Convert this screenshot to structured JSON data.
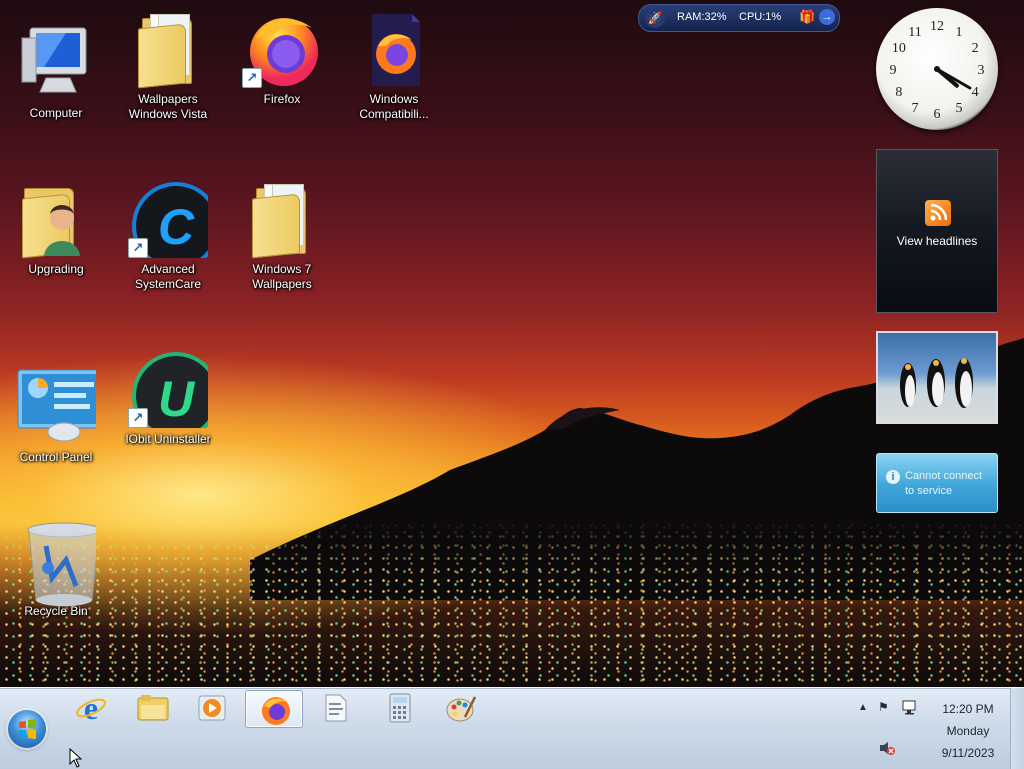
{
  "desktop": {
    "icons": [
      {
        "label": "Computer",
        "icon": "computer-icon"
      },
      {
        "label": "Wallpapers Windows Vista",
        "icon": "folder-icon"
      },
      {
        "label": "Firefox",
        "icon": "firefox-icon",
        "shortcut": true
      },
      {
        "label": "Windows Compatibili...",
        "icon": "firefox-document-icon"
      },
      {
        "label": "Upgrading",
        "icon": "user-folder-icon"
      },
      {
        "label": "Advanced SystemCare",
        "icon": "advanced-systemcare-icon",
        "shortcut": true
      },
      {
        "label": "Windows 7 Wallpapers",
        "icon": "folder-icon"
      },
      {
        "label": "Control Panel",
        "icon": "control-panel-icon"
      },
      {
        "label": "IObit Uninstaller",
        "icon": "iobit-uninstaller-icon",
        "shortcut": true
      },
      {
        "label": "Recycle Bin",
        "icon": "recycle-bin-icon"
      }
    ]
  },
  "gadgets": {
    "system_monitor": {
      "ram": "RAM:32%",
      "cpu": "CPU:1%"
    },
    "clock": {
      "hours": 4,
      "minutes": 20,
      "numerals": [
        "12",
        "1",
        "2",
        "3",
        "4",
        "5",
        "6",
        "7",
        "8",
        "9",
        "10",
        "11"
      ]
    },
    "feed_headlines": {
      "label": "View headlines"
    },
    "slideshow": {
      "subject": "penguins"
    },
    "weather": {
      "message": "Cannot connect to service"
    }
  },
  "taskbar": {
    "start_icon": "windows-start-icon",
    "pinned": [
      {
        "name": "internet-explorer",
        "icon": "internet-explorer-icon"
      },
      {
        "name": "windows-explorer",
        "icon": "folder-library-icon"
      },
      {
        "name": "media-player",
        "icon": "media-player-icon"
      },
      {
        "name": "firefox",
        "icon": "firefox-icon",
        "active": true
      },
      {
        "name": "document",
        "icon": "document-icon"
      },
      {
        "name": "calculator",
        "icon": "calculator-icon"
      },
      {
        "name": "paint",
        "icon": "paint-palette-icon"
      }
    ],
    "tray": {
      "time": "12:20 PM",
      "day": "Monday",
      "date": "9/11/2023"
    }
  },
  "colors": {
    "taskbar": "#cfdcea",
    "sky_top": "#1e0b10",
    "sky_glow": "#f2bf3a",
    "weather_gadget": "#3ea6d8",
    "sysmon": "#15234c"
  }
}
